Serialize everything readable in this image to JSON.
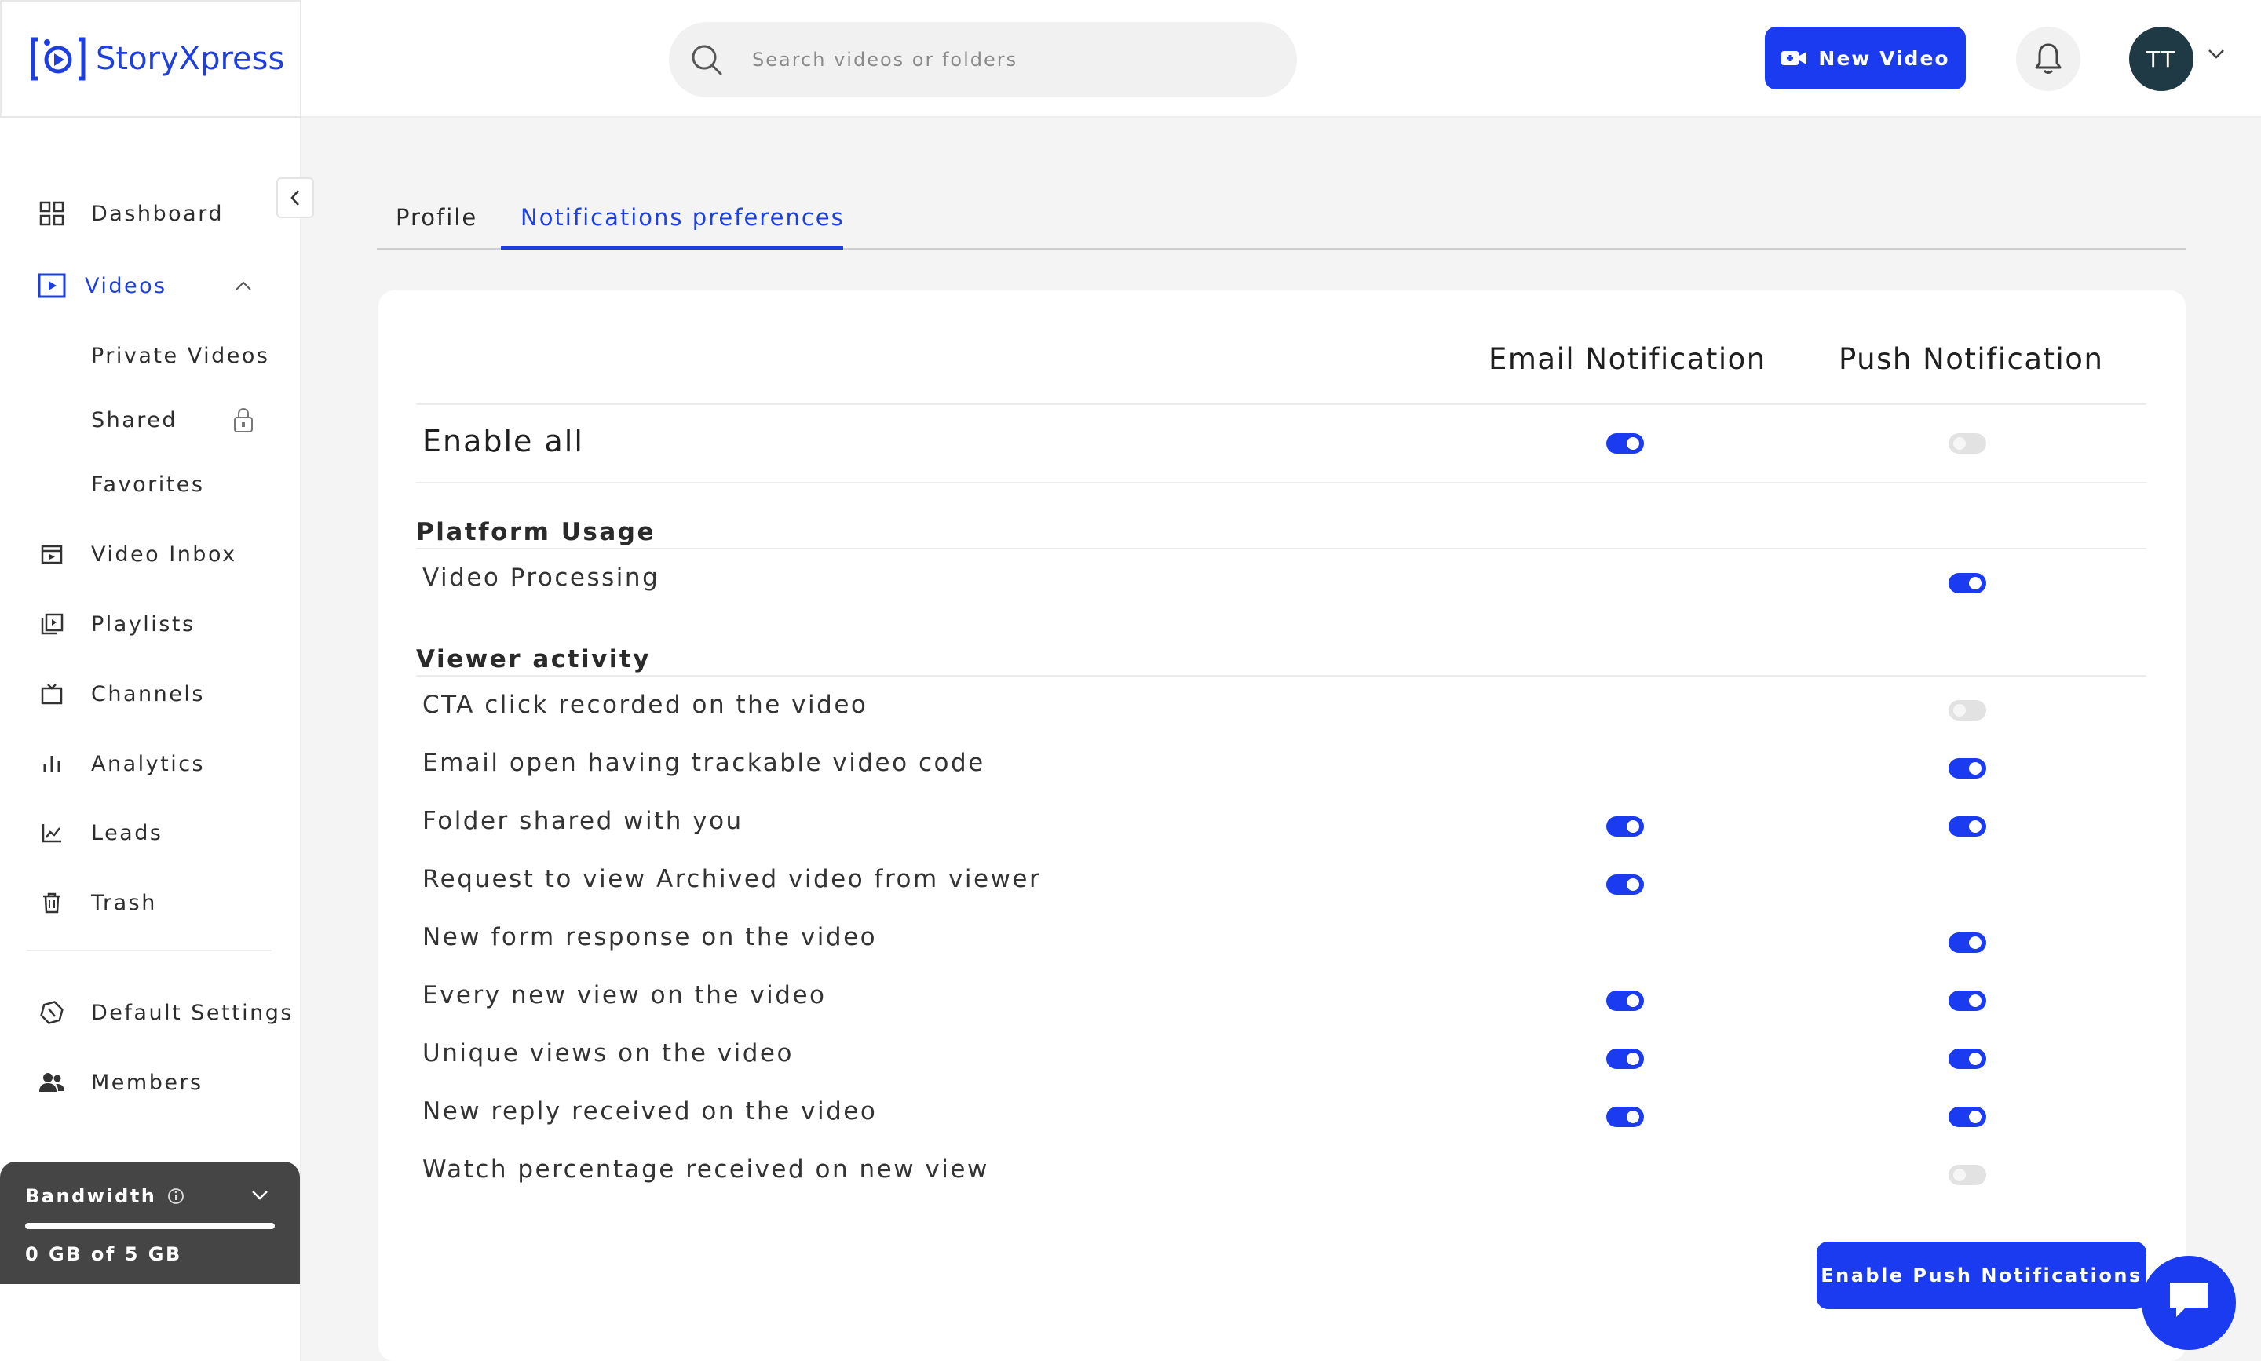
{
  "brand": {
    "name": "StoryXpress",
    "color": "#1d3fe0"
  },
  "header": {
    "search_placeholder": "Search videos or folders",
    "new_video_label": "New Video",
    "avatar_initials": "TT"
  },
  "sidebar": {
    "dashboard": "Dashboard",
    "videos": "Videos",
    "private_videos": "Private Videos",
    "shared": "Shared",
    "favorites": "Favorites",
    "video_inbox": "Video Inbox",
    "playlists": "Playlists",
    "channels": "Channels",
    "analytics": "Analytics",
    "leads": "Leads",
    "trash": "Trash",
    "default_settings": "Default Settings",
    "members": "Members"
  },
  "bandwidth": {
    "title": "Bandwidth",
    "usage": "0 GB of 5 GB",
    "used_fraction": 0
  },
  "tabs": {
    "profile": "Profile",
    "notifications": "Notifications preferences"
  },
  "table": {
    "email_header": "Email Notification",
    "push_header": "Push Notification",
    "enable_all": {
      "label": "Enable all",
      "email": true,
      "push": false
    },
    "sections": {
      "platform_usage": "Platform Usage",
      "viewer_activity": "Viewer activity"
    },
    "rows": [
      {
        "label": "Video Processing",
        "email": null,
        "push": true
      },
      {
        "label": "CTA click recorded on the video",
        "email": null,
        "push": false
      },
      {
        "label": "Email open having trackable video code",
        "email": null,
        "push": true
      },
      {
        "label": "Folder shared with you",
        "email": true,
        "push": true
      },
      {
        "label": "Request to view Archived video from viewer",
        "email": true,
        "push": null
      },
      {
        "label": "New form response on the video",
        "email": null,
        "push": true
      },
      {
        "label": "Every new view on the video",
        "email": true,
        "push": true
      },
      {
        "label": "Unique views on the video",
        "email": true,
        "push": true
      },
      {
        "label": "New reply received on the video",
        "email": true,
        "push": true
      },
      {
        "label": "Watch percentage received on new view",
        "email": null,
        "push": false
      }
    ]
  },
  "enable_push_label": "Enable Push Notifications",
  "colors": {
    "accent": "#1a3bf0",
    "toggle_off": "#e2e2e2",
    "bandwidth_bg": "#454545",
    "avatar_bg": "#1f3a45"
  }
}
